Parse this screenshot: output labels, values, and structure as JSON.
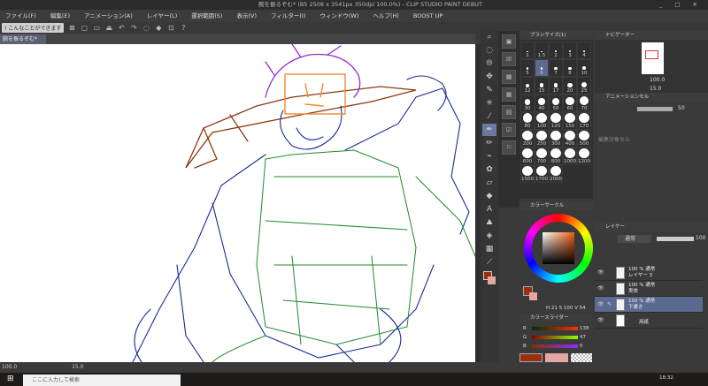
{
  "window": {
    "title": "腕を振るぞむ* (B5 2508 x 3541px 350dpi 100.0%) - CLIP STUDIO PAINT DEBUT",
    "controls": "_ □ ✕"
  },
  "menu": [
    "ファイル(F)",
    "編集(E)",
    "アニメーション(A)",
    "レイヤー(L)",
    "選択範囲(S)",
    "表示(V)",
    "フィルター(I)",
    "ウィンドウ(W)",
    "ヘルプ(H)",
    "BOOST UP"
  ],
  "toolbar": {
    "hint_button": "! こんなことができます"
  },
  "document_tab": "腕を振るぞむ*",
  "brush_size": {
    "title": "ブラシサイズ(1)",
    "sizes": [
      "1",
      "1.5",
      "2",
      "3",
      "4",
      "5",
      "6",
      "7",
      "8",
      "10",
      "12",
      "15",
      "17",
      "20",
      "25",
      "30",
      "40",
      "50",
      "60",
      "70",
      "80",
      "100",
      "120",
      "150",
      "170",
      "200",
      "250",
      "300",
      "400",
      "500",
      "600",
      "700",
      "800",
      "1000",
      "1200",
      "1500",
      "1700",
      "2000"
    ],
    "selected": "6"
  },
  "navigator": {
    "title": "ナビゲーター",
    "zoom": "100.0",
    "rotation": "15.0"
  },
  "animation_cel": {
    "title": "アニメーションセル",
    "opacity": "50",
    "empty_text": "編集対象セル"
  },
  "color_circle": {
    "title": "カラーサークル",
    "h": "21",
    "s": "100",
    "v": "54",
    "main_color": "#9a2f0a",
    "sub_color": "#e4a8a2"
  },
  "color_slider": {
    "title": "カラースライダー",
    "mode": "HSV RGB",
    "r_label": "R",
    "r": "138",
    "g_label": "G",
    "g": "47",
    "b_label": "B",
    "b": "0"
  },
  "layers": {
    "title": "レイヤー",
    "blend_mode": "通常",
    "opacity": "100",
    "items": [
      {
        "blend": "100 % 通常",
        "name": "レイヤー 3",
        "selected": false
      },
      {
        "blend": "100 % 通常",
        "name": "実体",
        "selected": false
      },
      {
        "blend": "100 % 通常",
        "name": "下書き",
        "selected": true
      },
      {
        "blend": "",
        "name": "用紙",
        "selected": false
      }
    ]
  },
  "statusbar": {
    "zoom": "100.0",
    "brush": "15.0"
  },
  "taskbar": {
    "search_placeholder": "ここに入力して検索",
    "time": "18:32"
  }
}
